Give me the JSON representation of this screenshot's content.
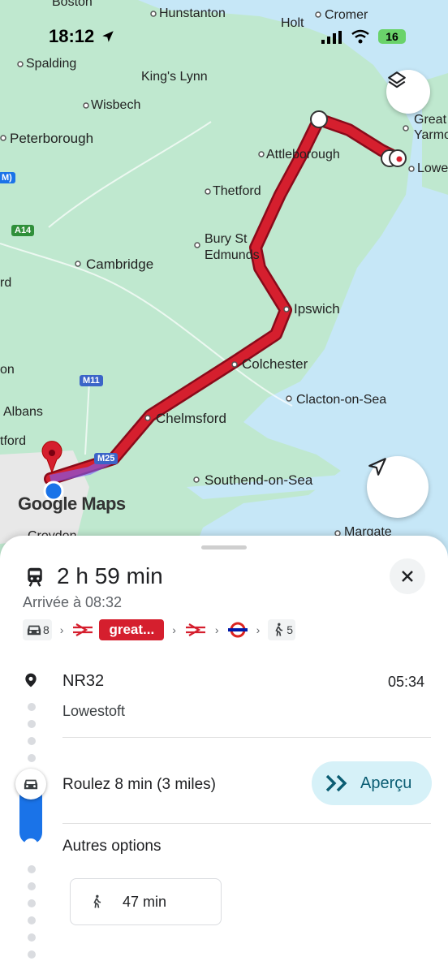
{
  "status_bar": {
    "time": "18:12",
    "battery": "16"
  },
  "map": {
    "labels": {
      "boston": "Boston",
      "hunstanton": "Hunstanton",
      "holt": "Holt",
      "cromer": "Cromer",
      "spalding": "Spalding",
      "kings_lynn": "King's Lynn",
      "wisbech": "Wisbech",
      "great_yarmouth_1": "Great",
      "great_yarmouth_2": "Yarmo",
      "peterborough": "Peterborough",
      "attleborough": "Attleborough",
      "lowestoft": "Lowe",
      "thetford": "Thetford",
      "bury_1": "Bury St",
      "bury_2": "Edmunds",
      "cambridge": "Cambridge",
      "rd": "rd",
      "ipswich": "Ipswich",
      "on": "on",
      "colchester": "Colchester",
      "clacton": "Clacton-on-Sea",
      "albans": "Albans",
      "chelmsford": "Chelmsford",
      "tford": "tford",
      "southend": "Southend-on-Sea",
      "margate": "Margate",
      "croydon": "Croydon",
      "m_left": "M)",
      "google_maps": "Google Maps"
    },
    "roads": {
      "a14": "A14",
      "m11": "M11",
      "m25": "M25"
    },
    "layers_icon": "layers-icon",
    "locate_icon": "navigation-arrow-icon"
  },
  "route": {
    "duration": "2 h 59 min",
    "arrival": "Arrivée à 08:32",
    "steps": {
      "car_count": "8",
      "great": "great...",
      "walk_count": "5"
    },
    "origin": {
      "name": "NR32",
      "time": "05:34",
      "place": "Lowestoft"
    },
    "drive": {
      "label": "Roulez 8 min (3 miles)",
      "button": "Aperçu"
    },
    "other_options": {
      "label": "Autres options",
      "walk_time": "47 min"
    }
  },
  "colors": {
    "route_red": "#c8102e",
    "timeline_blue": "#1a73e8",
    "map_land": "#bfe8cf",
    "sea": "#c6e7f7"
  }
}
